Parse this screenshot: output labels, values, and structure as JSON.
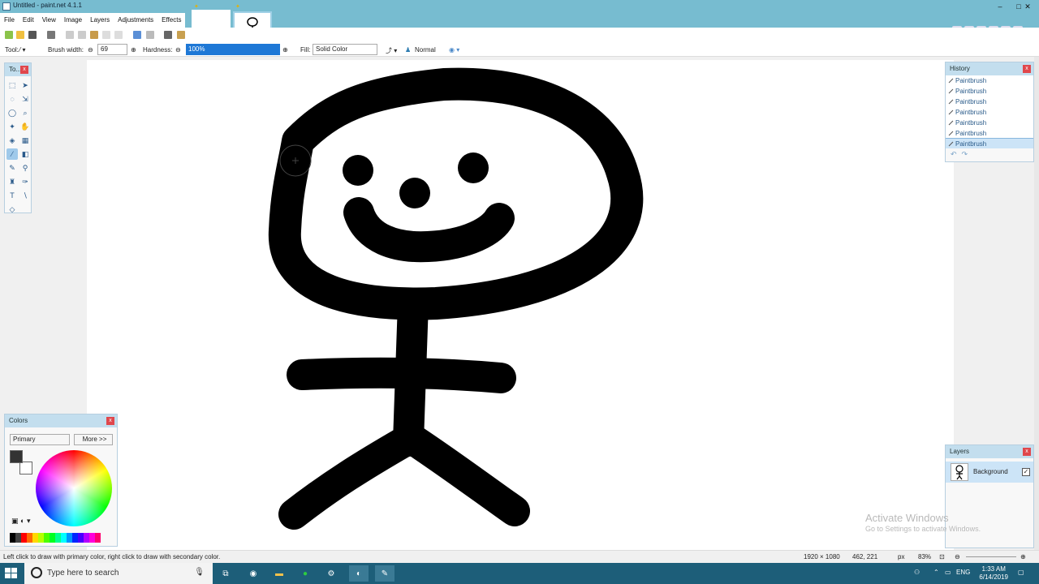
{
  "window": {
    "title": "Untitled - paint.net 4.1.1",
    "min": "–",
    "max": "□",
    "close": "✕"
  },
  "menu": [
    "File",
    "Edit",
    "View",
    "Image",
    "Layers",
    "Adjustments",
    "Effects"
  ],
  "toolbar2": {
    "tool_label": "Tool:",
    "brush_width_label": "Brush width:",
    "brush_width_value": "69",
    "hardness_label": "Hardness:",
    "hardness_value": "100%",
    "fill_label": "Fill:",
    "fill_value": "Solid Color",
    "blend_value": "Normal"
  },
  "tools_panel": {
    "title": "To..."
  },
  "history_panel": {
    "title": "History",
    "items": [
      "Paintbrush",
      "Paintbrush",
      "Paintbrush",
      "Paintbrush",
      "Paintbrush",
      "Paintbrush",
      "Paintbrush"
    ],
    "selected_index": 6
  },
  "layers_panel": {
    "title": "Layers",
    "layer_name": "Background",
    "visible_check": "✓"
  },
  "colors_panel": {
    "title": "Colors",
    "mode": "Primary",
    "more": "More >>"
  },
  "status": {
    "hint": "Left click to draw with primary color, right click to draw with secondary color.",
    "size": "1920 × 1080",
    "position": "462, 221",
    "units": "px",
    "zoom": "83%"
  },
  "watermark": {
    "line1": "Activate Windows",
    "line2": "Go to Settings to activate Windows."
  },
  "taskbar": {
    "search_placeholder": "Type here to search",
    "lang": "ENG",
    "time": "1:33 AM",
    "date": "6/14/2019"
  },
  "colors": {
    "accent": "#77bcd0",
    "taskbar": "#1d5e79",
    "selection": "#1e78d6",
    "primary_color": "#333333"
  }
}
